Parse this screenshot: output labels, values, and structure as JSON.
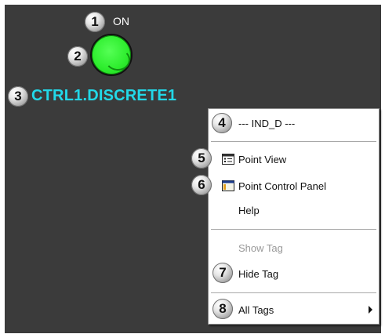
{
  "display": {
    "state_text": "ON",
    "tag_name": "CTRL1.DISCRETE1",
    "indicator_color": "#33ee33",
    "text_color": "#22d8e8"
  },
  "callouts": [
    "1",
    "2",
    "3",
    "4",
    "5",
    "6",
    "7",
    "8"
  ],
  "context_menu": {
    "header": "--- IND_D ---",
    "items": {
      "point_view": "Point View",
      "point_control_panel": "Point Control Panel",
      "help": "Help",
      "show_tag": "Show Tag",
      "hide_tag": "Hide Tag",
      "all_tags": "All Tags"
    },
    "icons": {
      "point_view": "point-view-icon",
      "point_control_panel": "control-panel-icon",
      "all_tags": "submenu-arrow-icon"
    }
  }
}
